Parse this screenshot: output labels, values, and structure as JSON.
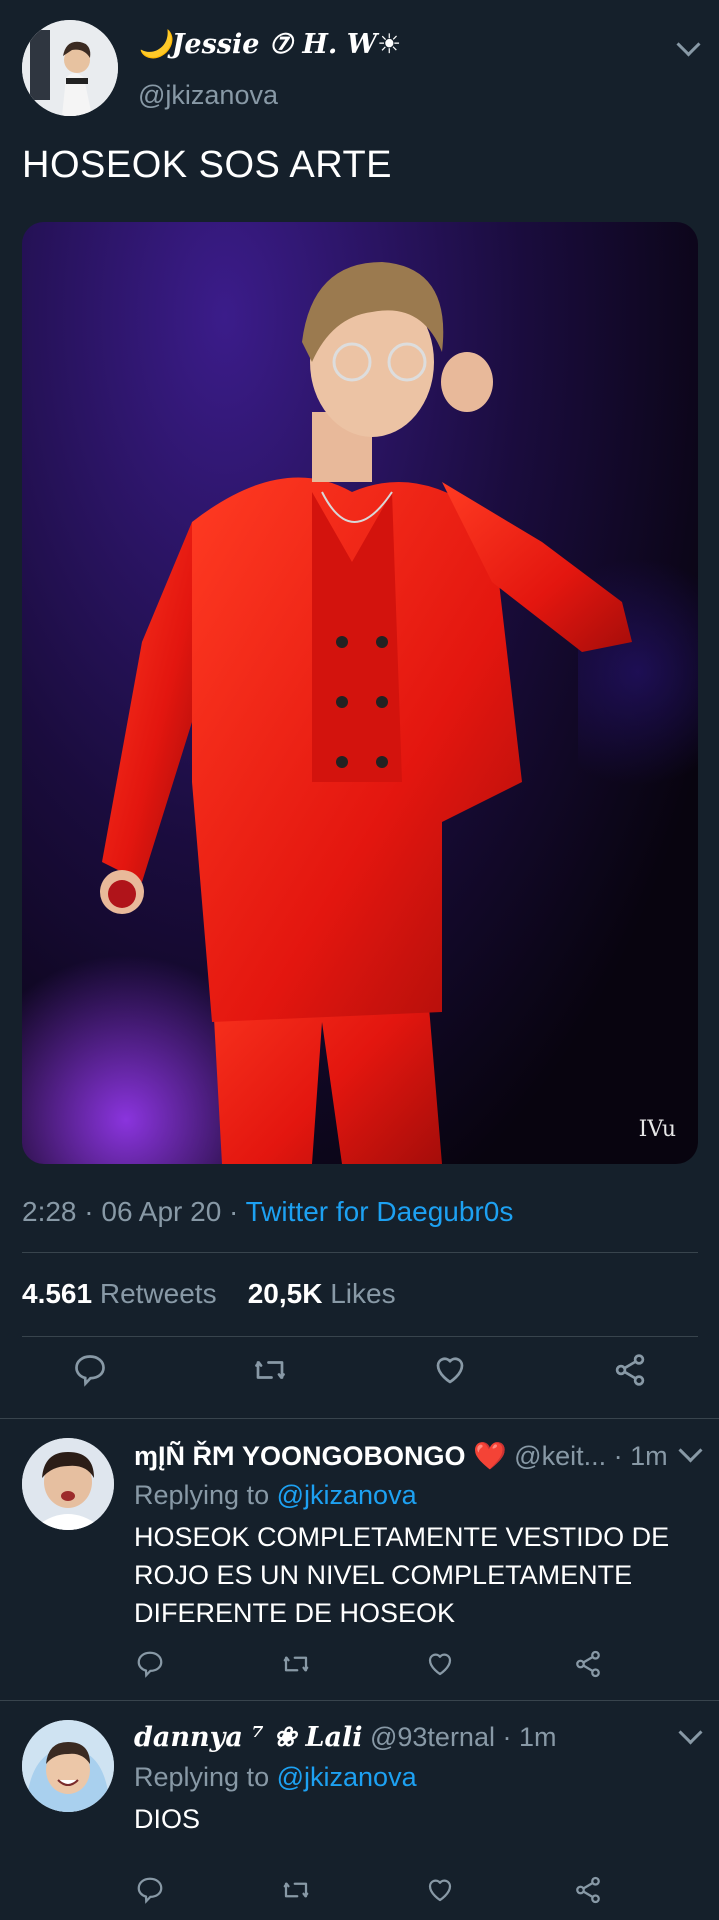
{
  "tweet": {
    "author": {
      "display_name": "🌙Jessie ⑦ H. W☀",
      "handle": "@jkizanova"
    },
    "text": "HOSEOK SOS ARTE",
    "media": {
      "watermark": "IVu"
    },
    "meta": {
      "time": "2:28",
      "date": "06 Apr 20",
      "separator": "·",
      "source": "Twitter for Daegubr0s"
    },
    "stats": {
      "retweets_count": "4.561",
      "retweets_label": "Retweets",
      "likes_count": "20,5K",
      "likes_label": "Likes"
    },
    "actions": [
      "reply-icon",
      "retweet-icon",
      "like-icon",
      "share-icon"
    ]
  },
  "replies": [
    {
      "display_name": "ɱĮÑ ŘϺ YOONGOBONGO ❤️",
      "handle": "@keit...",
      "time": "1m",
      "replying_prefix": "Replying to",
      "replying_to": "@jkizanova",
      "text": "HOSEOK COMPLETAMENTE VESTIDO DE ROJO ES UN NIVEL COMPLETAMENTE DIFERENTE DE HOSEOK"
    },
    {
      "display_name": "dannya ⁷ ❀ Lali",
      "handle": "@93ternal",
      "time": "1m",
      "replying_prefix": "Replying to",
      "replying_to": "@jkizanova",
      "text": "DIOS"
    }
  ],
  "colors": {
    "background": "#15202b",
    "muted": "#8899a6",
    "accent": "#1da1f2",
    "divider": "#38444d"
  }
}
